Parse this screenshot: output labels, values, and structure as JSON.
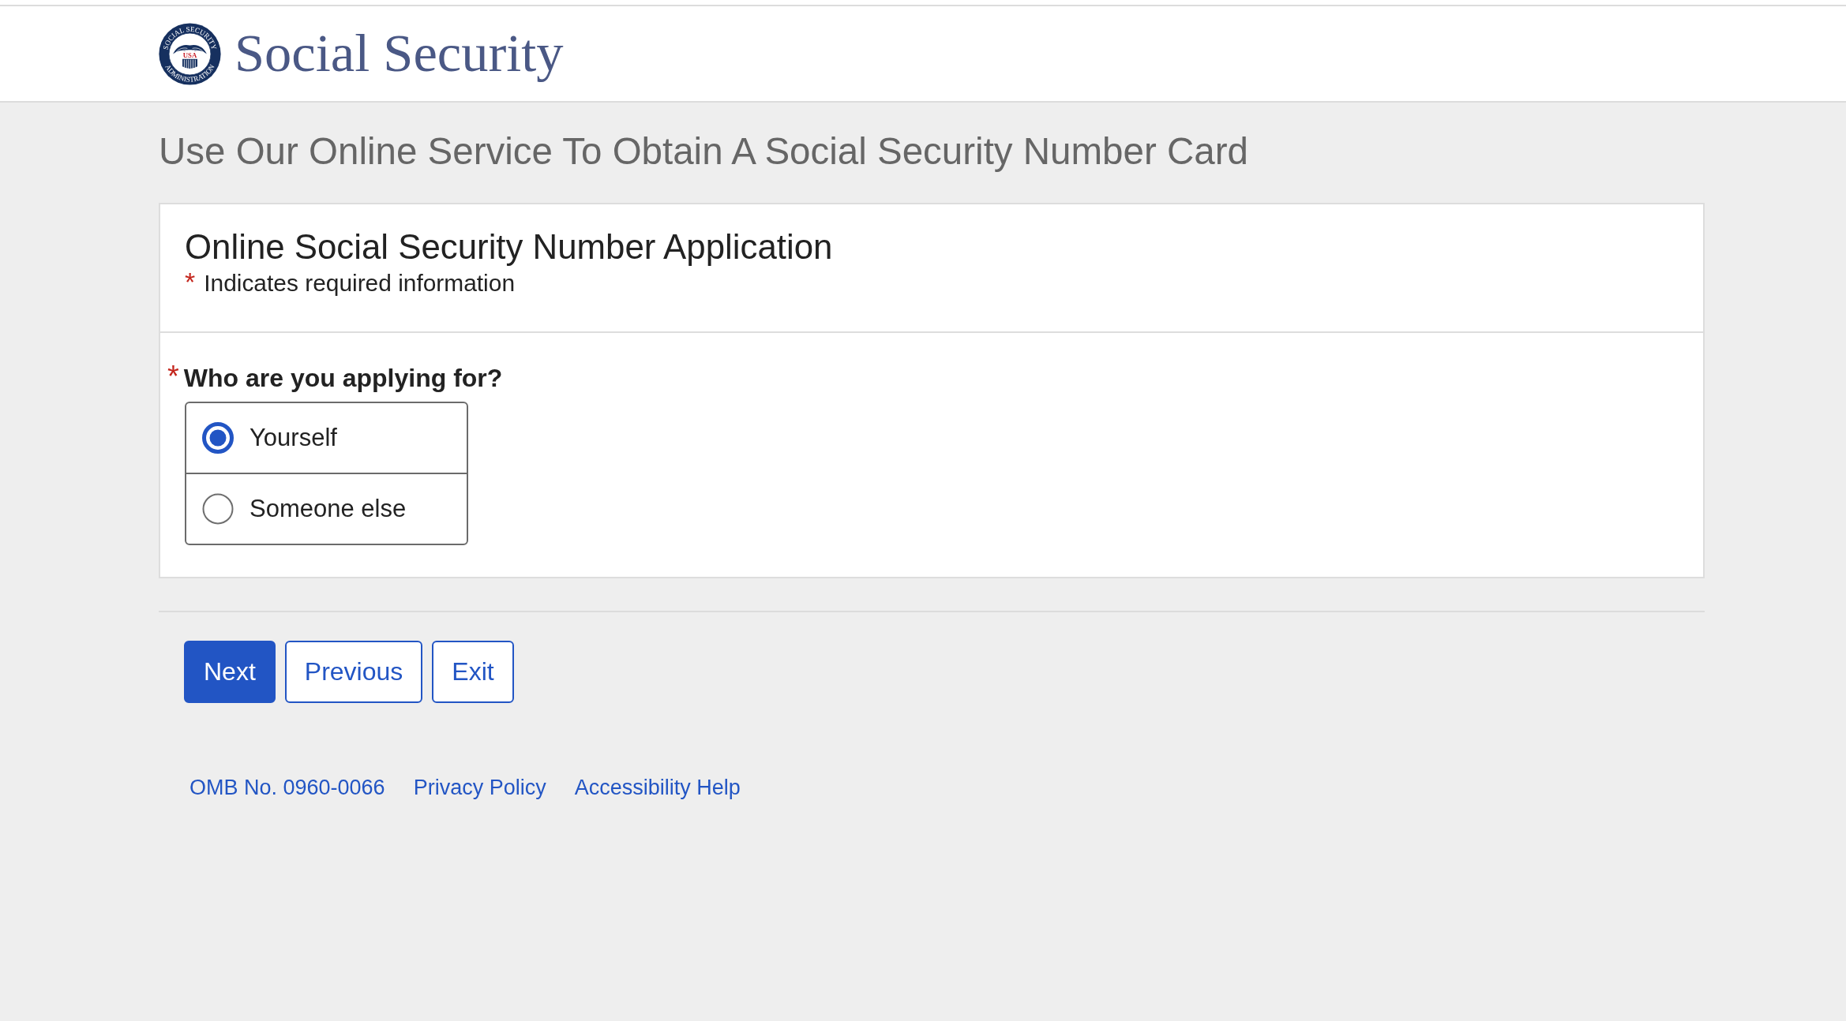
{
  "header": {
    "seal": {
      "top_text": "SOCIAL SECURITY",
      "center_text": "USA",
      "bottom_text": "ADMINISTRATION"
    },
    "agency_name": "Social Security"
  },
  "page_title": "Use Our Online Service To Obtain A Social Security Number Card",
  "form": {
    "title": "Online Social Security Number Application",
    "required_note": {
      "required_marker": "*",
      "text": "Indicates required information"
    },
    "question": {
      "required_marker": "*",
      "label": "Who are you applying for?",
      "options": [
        {
          "label": "Yourself",
          "selected": true
        },
        {
          "label": "Someone else",
          "selected": false
        }
      ]
    }
  },
  "buttons": [
    {
      "label": "Next",
      "kind": "primary"
    },
    {
      "label": "Previous",
      "kind": "secondary"
    },
    {
      "label": "Exit",
      "kind": "secondary"
    }
  ],
  "footer_links": [
    "OMB No. 0960-0066",
    "Privacy Policy",
    "Accessibility Help"
  ]
}
